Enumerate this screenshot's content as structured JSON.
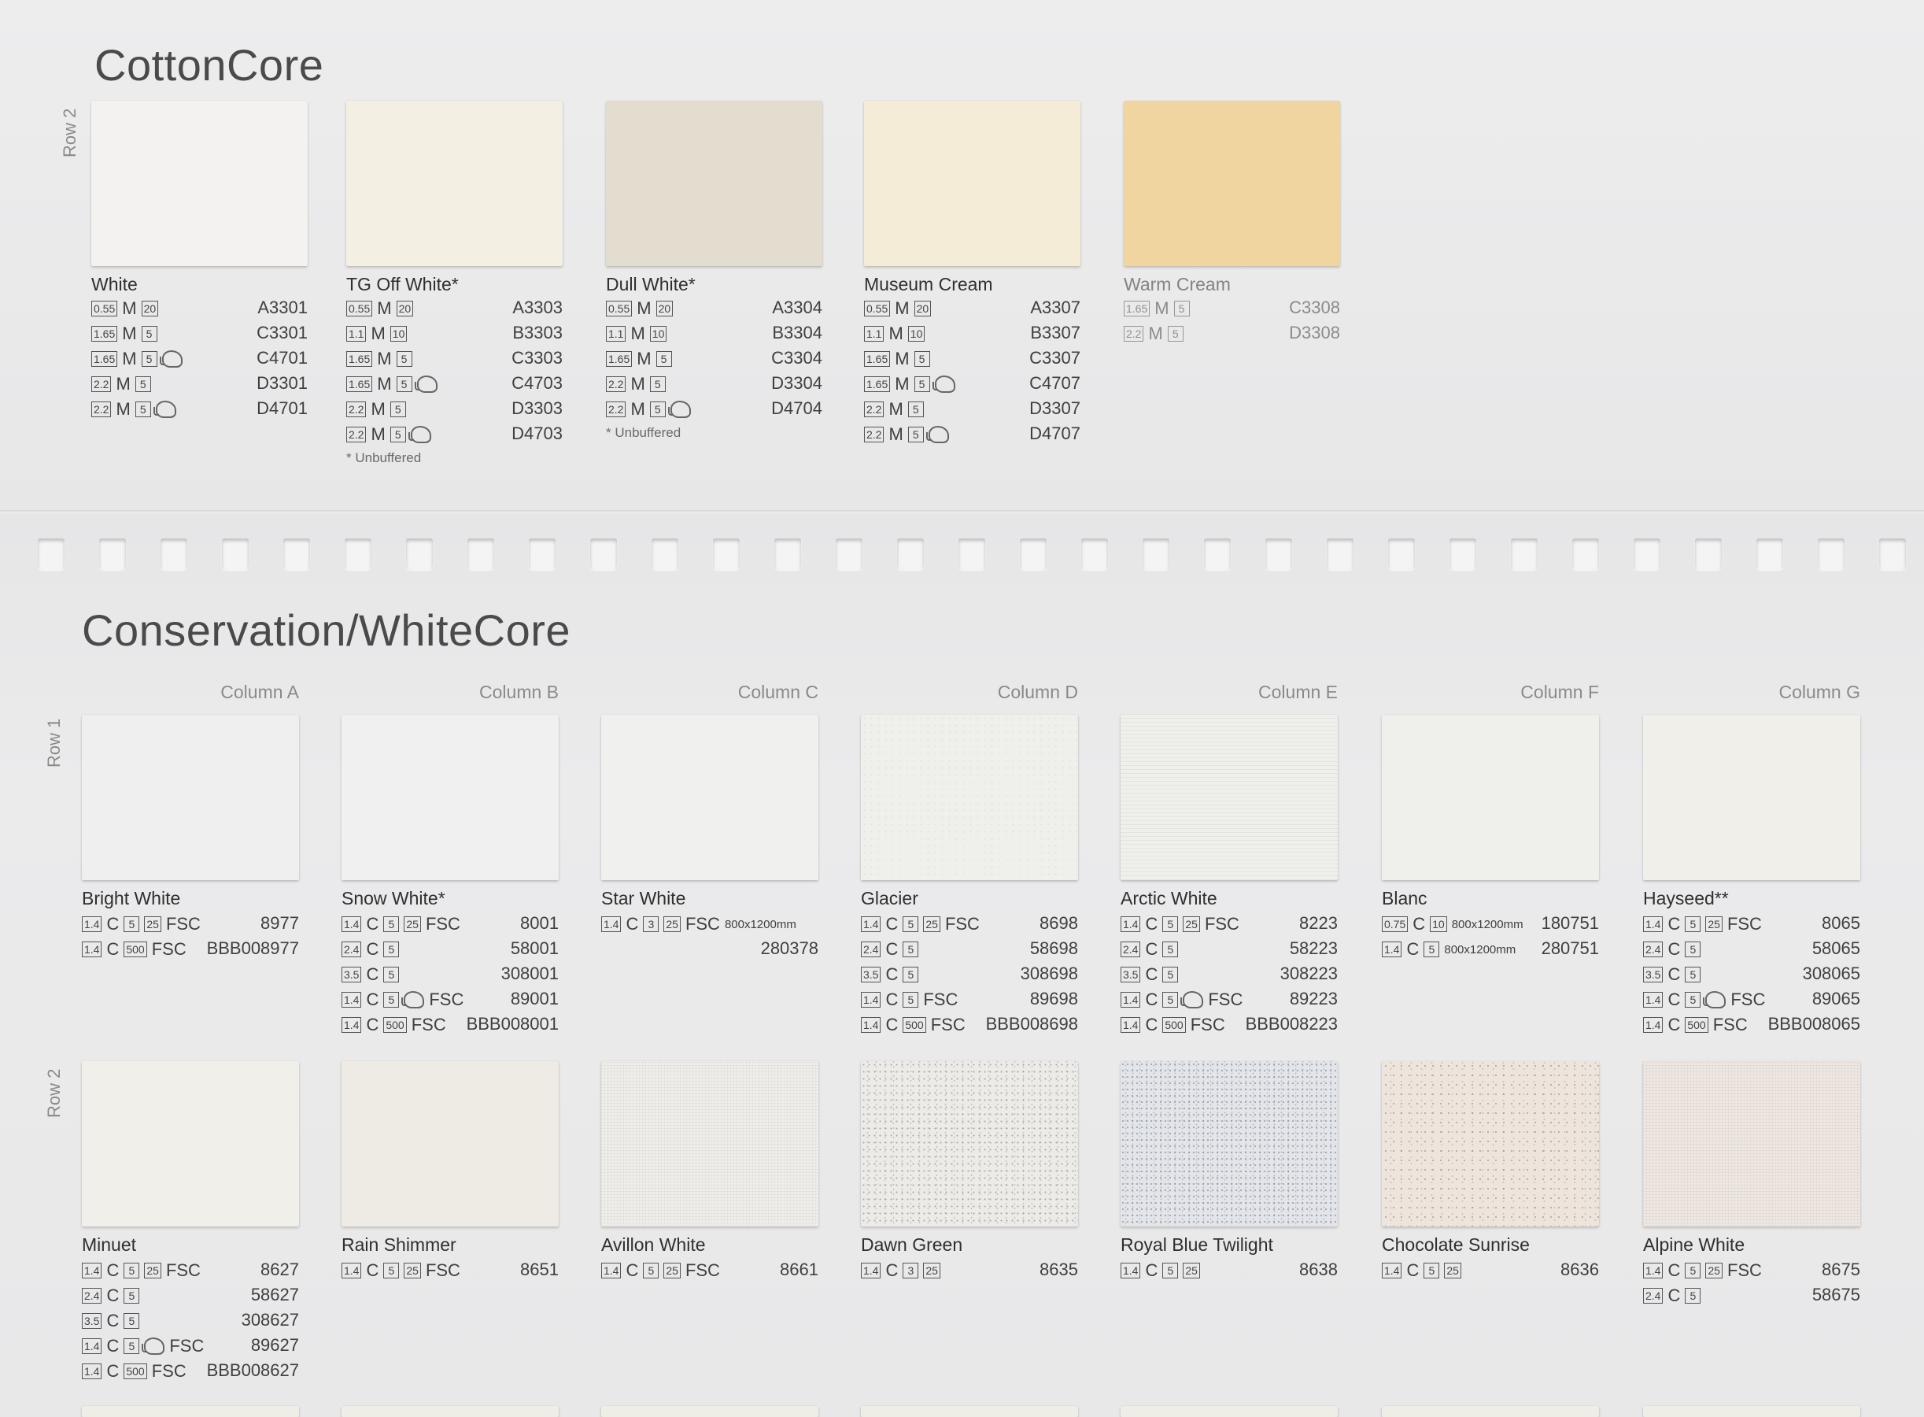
{
  "cottoncore": {
    "title": "CottonCore",
    "row_label": "Row 2",
    "swatches": [
      {
        "name": "White",
        "color": "#f3f2f0",
        "specs": [
          {
            "weight": "0.55",
            "type": "M",
            "pack": "20",
            "elephant": false,
            "code": "A3301"
          },
          {
            "weight": "1.65",
            "type": "M",
            "pack": "5",
            "elephant": false,
            "code": "C3301"
          },
          {
            "weight": "1.65",
            "type": "M",
            "pack": "5",
            "elephant": true,
            "code": "C4701"
          },
          {
            "weight": "2.2",
            "type": "M",
            "pack": "5",
            "elephant": false,
            "code": "D3301"
          },
          {
            "weight": "2.2",
            "type": "M",
            "pack": "5",
            "elephant": true,
            "code": "D4701"
          }
        ],
        "note": ""
      },
      {
        "name": "TG Off White*",
        "color": "#f3efe2",
        "specs": [
          {
            "weight": "0.55",
            "type": "M",
            "pack": "20",
            "elephant": false,
            "code": "A3303"
          },
          {
            "weight": "1.1",
            "type": "M",
            "pack": "10",
            "elephant": false,
            "code": "B3303"
          },
          {
            "weight": "1.65",
            "type": "M",
            "pack": "5",
            "elephant": false,
            "code": "C3303"
          },
          {
            "weight": "1.65",
            "type": "M",
            "pack": "5",
            "elephant": true,
            "code": "C4703"
          },
          {
            "weight": "2.2",
            "type": "M",
            "pack": "5",
            "elephant": false,
            "code": "D3303"
          },
          {
            "weight": "2.2",
            "type": "M",
            "pack": "5",
            "elephant": true,
            "code": "D4703"
          }
        ],
        "note": "* Unbuffered"
      },
      {
        "name": "Dull White*",
        "color": "#e3ddcf",
        "specs": [
          {
            "weight": "0.55",
            "type": "M",
            "pack": "20",
            "elephant": false,
            "code": "A3304"
          },
          {
            "weight": "1.1",
            "type": "M",
            "pack": "10",
            "elephant": false,
            "code": "B3304"
          },
          {
            "weight": "1.65",
            "type": "M",
            "pack": "5",
            "elephant": false,
            "code": "C3304"
          },
          {
            "weight": "2.2",
            "type": "M",
            "pack": "5",
            "elephant": false,
            "code": "D3304"
          },
          {
            "weight": "2.2",
            "type": "M",
            "pack": "5",
            "elephant": true,
            "code": "D4704"
          }
        ],
        "note": "* Unbuffered"
      },
      {
        "name": "Museum Cream",
        "color": "#f4ecd6",
        "specs": [
          {
            "weight": "0.55",
            "type": "M",
            "pack": "20",
            "elephant": false,
            "code": "A3307"
          },
          {
            "weight": "1.1",
            "type": "M",
            "pack": "10",
            "elephant": false,
            "code": "B3307"
          },
          {
            "weight": "1.65",
            "type": "M",
            "pack": "5",
            "elephant": false,
            "code": "C3307"
          },
          {
            "weight": "1.65",
            "type": "M",
            "pack": "5",
            "elephant": true,
            "code": "C4707"
          },
          {
            "weight": "2.2",
            "type": "M",
            "pack": "5",
            "elephant": false,
            "code": "D3307"
          },
          {
            "weight": "2.2",
            "type": "M",
            "pack": "5",
            "elephant": true,
            "code": "D4707"
          }
        ],
        "note": ""
      },
      {
        "name": "Warm Cream",
        "color": "#f0d5a1",
        "faded": true,
        "specs": [
          {
            "weight": "1.65",
            "type": "M",
            "pack": "5",
            "elephant": false,
            "code": "C3308"
          },
          {
            "weight": "2.2",
            "type": "M",
            "pack": "5",
            "elephant": false,
            "code": "D3308"
          }
        ],
        "note": ""
      }
    ]
  },
  "conservation": {
    "title": "Conservation/WhiteCore",
    "columns": [
      "Column A",
      "Column B",
      "Column C",
      "Column D",
      "Column E",
      "Column F",
      "Column G"
    ],
    "rows": [
      {
        "label": "Row 1",
        "swatches": [
          {
            "name": "Bright White",
            "color": "#efefef",
            "texture": "",
            "specs": [
              {
                "weight": "1.4",
                "type": "C",
                "pack": "5",
                "pack2": "25",
                "fsc": "FSC",
                "code": "8977"
              },
              {
                "weight": "1.4",
                "type": "C",
                "pack": "500",
                "fsc": "FSC",
                "code": "BBB008977"
              }
            ]
          },
          {
            "name": "Snow White*",
            "color": "#f1f0f0",
            "texture": "",
            "specs": [
              {
                "weight": "1.4",
                "type": "C",
                "pack": "5",
                "pack2": "25",
                "fsc": "FSC",
                "code": "8001"
              },
              {
                "weight": "2.4",
                "type": "C",
                "pack": "5",
                "code": "58001"
              },
              {
                "weight": "3.5",
                "type": "C",
                "pack": "5",
                "code": "308001"
              },
              {
                "weight": "1.4",
                "type": "C",
                "pack": "5",
                "elephant": true,
                "fsc": "FSC",
                "code": "89001"
              },
              {
                "weight": "1.4",
                "type": "C",
                "pack": "500",
                "fsc": "FSC",
                "code": "BBB008001"
              }
            ]
          },
          {
            "name": "Star White",
            "color": "#f0f0ef",
            "texture": "",
            "specs": [
              {
                "weight": "1.4",
                "type": "C",
                "pack": "3",
                "pack2": "25",
                "fsc": "FSC",
                "size": "800x1200mm",
                "code": ""
              },
              {
                "code": "280378"
              }
            ]
          },
          {
            "name": "Glacier",
            "color": "#efefec",
            "texture": "tex-faint",
            "specs": [
              {
                "weight": "1.4",
                "type": "C",
                "pack": "5",
                "pack2": "25",
                "fsc": "FSC",
                "code": "8698"
              },
              {
                "weight": "2.4",
                "type": "C",
                "pack": "5",
                "code": "58698"
              },
              {
                "weight": "3.5",
                "type": "C",
                "pack": "5",
                "code": "308698"
              },
              {
                "weight": "1.4",
                "type": "C",
                "pack": "5",
                "fsc": "FSC",
                "code": "89698"
              },
              {
                "weight": "1.4",
                "type": "C",
                "pack": "500",
                "fsc": "FSC",
                "code": "BBB008698"
              }
            ]
          },
          {
            "name": "Arctic White",
            "color": "#efefeb",
            "texture": "tex-lines",
            "specs": [
              {
                "weight": "1.4",
                "type": "C",
                "pack": "5",
                "pack2": "25",
                "fsc": "FSC",
                "code": "8223"
              },
              {
                "weight": "2.4",
                "type": "C",
                "pack": "5",
                "code": "58223"
              },
              {
                "weight": "3.5",
                "type": "C",
                "pack": "5",
                "code": "308223"
              },
              {
                "weight": "1.4",
                "type": "C",
                "pack": "5",
                "elephant": true,
                "fsc": "FSC",
                "code": "89223"
              },
              {
                "weight": "1.4",
                "type": "C",
                "pack": "500",
                "fsc": "FSC",
                "code": "BBB008223"
              }
            ]
          },
          {
            "name": "Blanc",
            "color": "#efefec",
            "texture": "",
            "specs": [
              {
                "weight": "0.75",
                "type": "C",
                "pack": "10",
                "size": "800x1200mm",
                "code": "180751"
              },
              {
                "weight": "1.4",
                "type": "C",
                "pack": "5",
                "size": "800x1200mm",
                "code": "280751"
              }
            ]
          },
          {
            "name": "Hayseed**",
            "color": "#f0efea",
            "texture": "",
            "specs": [
              {
                "weight": "1.4",
                "type": "C",
                "pack": "5",
                "pack2": "25",
                "fsc": "FSC",
                "code": "8065"
              },
              {
                "weight": "2.4",
                "type": "C",
                "pack": "5",
                "code": "58065"
              },
              {
                "weight": "3.5",
                "type": "C",
                "pack": "5",
                "code": "308065"
              },
              {
                "weight": "1.4",
                "type": "C",
                "pack": "5",
                "elephant": true,
                "fsc": "FSC",
                "code": "89065"
              },
              {
                "weight": "1.4",
                "type": "C",
                "pack": "500",
                "fsc": "FSC",
                "code": "BBB008065"
              }
            ]
          }
        ]
      },
      {
        "label": "Row 2",
        "swatches": [
          {
            "name": "Minuet",
            "color": "#f0efea",
            "texture": "",
            "specs": [
              {
                "weight": "1.4",
                "type": "C",
                "pack": "5",
                "pack2": "25",
                "fsc": "FSC",
                "code": "8627"
              },
              {
                "weight": "2.4",
                "type": "C",
                "pack": "5",
                "code": "58627"
              },
              {
                "weight": "3.5",
                "type": "C",
                "pack": "5",
                "code": "308627"
              },
              {
                "weight": "1.4",
                "type": "C",
                "pack": "5",
                "elephant": true,
                "fsc": "FSC",
                "code": "89627"
              },
              {
                "weight": "1.4",
                "type": "C",
                "pack": "500",
                "fsc": "FSC",
                "code": "BBB008627"
              }
            ]
          },
          {
            "name": "Rain Shimmer",
            "color": "#eeebe4",
            "texture": "",
            "specs": [
              {
                "weight": "1.4",
                "type": "C",
                "pack": "5",
                "pack2": "25",
                "fsc": "FSC",
                "code": "8651"
              }
            ]
          },
          {
            "name": "Avillon White",
            "color": "#efeeea",
            "texture": "tex-linen",
            "specs": [
              {
                "weight": "1.4",
                "type": "C",
                "pack": "5",
                "pack2": "25",
                "fsc": "FSC",
                "code": "8661"
              }
            ]
          },
          {
            "name": "Dawn Green",
            "color": "#ecebe7",
            "texture": "tex-speckle",
            "specs": [
              {
                "weight": "1.4",
                "type": "C",
                "pack": "3",
                "pack2": "25",
                "code": "8635"
              }
            ]
          },
          {
            "name": "Royal Blue Twilight",
            "color": "#e4e5e8",
            "texture": "tex-blue",
            "specs": [
              {
                "weight": "1.4",
                "type": "C",
                "pack": "5",
                "pack2": "25",
                "code": "8638"
              }
            ]
          },
          {
            "name": "Chocolate Sunrise",
            "color": "#ede4dc",
            "texture": "tex-choc",
            "specs": [
              {
                "weight": "1.4",
                "type": "C",
                "pack": "5",
                "pack2": "25",
                "code": "8636"
              }
            ]
          },
          {
            "name": "Alpine White",
            "color": "#efe8e2",
            "texture": "tex-linen",
            "specs": [
              {
                "weight": "1.4",
                "type": "C",
                "pack": "5",
                "pack2": "25",
                "fsc": "FSC",
                "code": "8675"
              },
              {
                "weight": "2.4",
                "type": "C",
                "pack": "5",
                "code": "58675"
              }
            ]
          }
        ]
      }
    ]
  }
}
